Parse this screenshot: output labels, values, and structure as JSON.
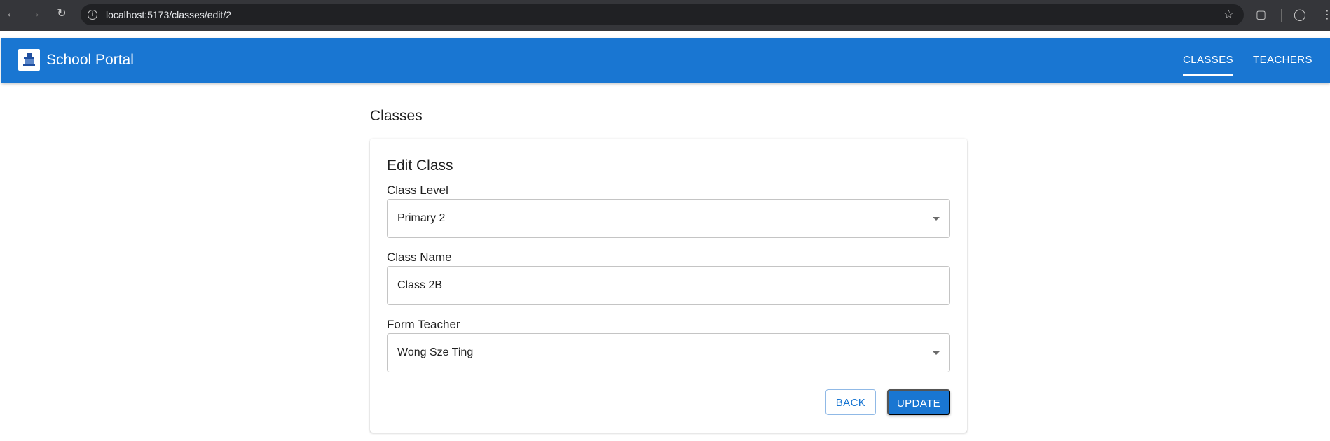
{
  "browser": {
    "url": "localhost:5173/classes/edit/2"
  },
  "appbar": {
    "brand": "School Portal",
    "nav": [
      {
        "label": "CLASSES",
        "active": true
      },
      {
        "label": "TEACHERS",
        "active": false
      }
    ]
  },
  "page": {
    "title": "Classes"
  },
  "form": {
    "title": "Edit Class",
    "class_level": {
      "label": "Class Level",
      "value": "Primary 2"
    },
    "class_name": {
      "label": "Class Name",
      "value": "Class 2B"
    },
    "form_teacher": {
      "label": "Form Teacher",
      "value": "Wong Sze Ting"
    },
    "back_label": "BACK",
    "update_label": "UPDATE"
  },
  "colors": {
    "primary": "#1976d2",
    "chrome": "#35363a"
  },
  "icons": [
    "back-arrow-icon",
    "forward-arrow-icon",
    "reload-icon",
    "site-info-icon",
    "bookmark-star-icon",
    "extensions-icon",
    "profile-icon",
    "menu-icon",
    "school-logo-icon",
    "dropdown-caret-icon"
  ]
}
